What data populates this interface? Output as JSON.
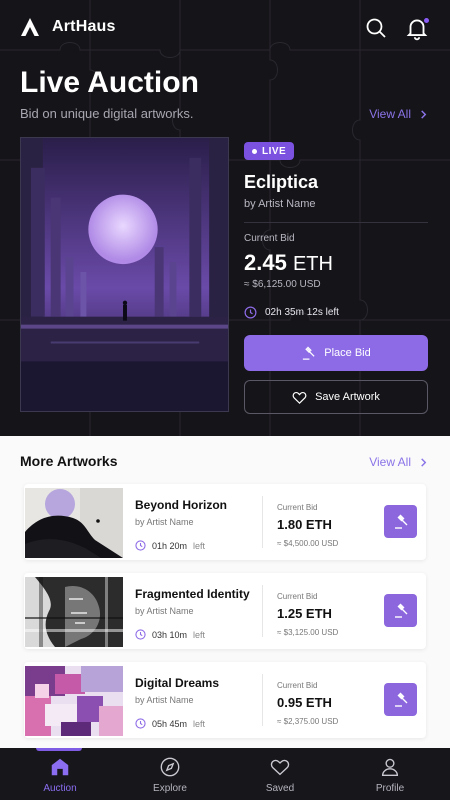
{
  "app": {
    "name": "ArtHaus"
  },
  "colors": {
    "accent": "#8d6be6",
    "dark_bg": "#151418",
    "nav_bg": "#17161b"
  },
  "hero": {
    "title": "Live Auction",
    "subtitle": "Bid on unique digital artworks.",
    "view_all": "View All",
    "featured": {
      "badge": "LIVE",
      "name": "Ecliptica",
      "artist": "by Artist Name",
      "current_bid_label": "Current Bid",
      "bid_amount": "2.45",
      "bid_unit": "ETH",
      "bid_usd": "≈ $6,125.00 USD",
      "time_left": "02h 35m 12s left",
      "place_bid_label": "Place Bid",
      "save_label": "Save Artwork"
    }
  },
  "more": {
    "title": "More Artworks",
    "view_all": "View All",
    "items": [
      {
        "title": "Beyond Horizon",
        "artist": "by Artist Name",
        "time": "01h 20m",
        "time_suffix": "left",
        "bid_label": "Current Bid",
        "eth": "1.80 ETH",
        "usd": "≈ $4,500.00 USD"
      },
      {
        "title": "Fragmented Identity",
        "artist": "by Artist Name",
        "time": "03h 10m",
        "time_suffix": "left",
        "bid_label": "Current Bid",
        "eth": "1.25 ETH",
        "usd": "≈ $3,125.00 USD"
      },
      {
        "title": "Digital Dreams",
        "artist": "by Artist Name",
        "time": "05h 45m",
        "time_suffix": "left",
        "bid_label": "Current Bid",
        "eth": "0.95 ETH",
        "usd": "≈ $2,375.00 USD"
      }
    ]
  },
  "nav": {
    "active": "Auction",
    "items": [
      {
        "label": "Auction",
        "icon": "home-icon"
      },
      {
        "label": "Explore",
        "icon": "compass-icon"
      },
      {
        "label": "Saved",
        "icon": "heart-icon"
      },
      {
        "label": "Profile",
        "icon": "user-icon"
      }
    ]
  }
}
